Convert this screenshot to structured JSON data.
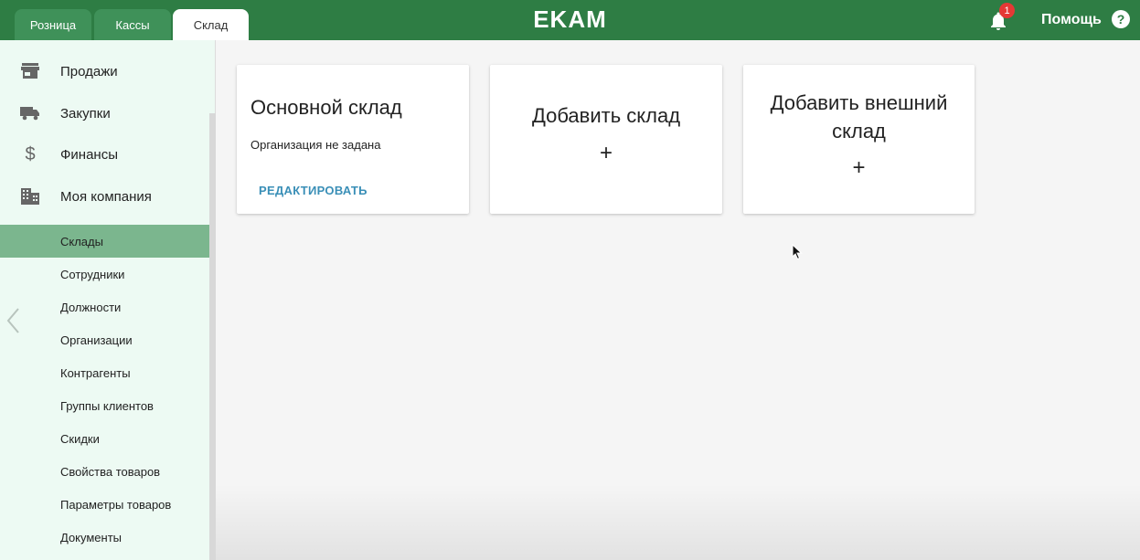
{
  "tabs": [
    {
      "label": "Розница"
    },
    {
      "label": "Кассы"
    },
    {
      "label": "Склад"
    }
  ],
  "active_tab": "Склад",
  "logo": "EKAM",
  "notifications": {
    "count": "1",
    "icon": "bell-icon"
  },
  "help": {
    "label": "Помощь",
    "icon": "help-icon",
    "glyph": "?"
  },
  "sidebar": {
    "sections": [
      {
        "label": "Продажи",
        "icon": "store-icon"
      },
      {
        "label": "Закупки",
        "icon": "truck-icon"
      },
      {
        "label": "Финансы",
        "icon": "dollar-icon"
      },
      {
        "label": "Моя компания",
        "icon": "building-icon"
      }
    ],
    "items": [
      {
        "label": "Склады",
        "active": true
      },
      {
        "label": "Сотрудники"
      },
      {
        "label": "Должности"
      },
      {
        "label": "Организации"
      },
      {
        "label": "Контрагенты"
      },
      {
        "label": "Группы клиентов"
      },
      {
        "label": "Скидки"
      },
      {
        "label": "Свойства товаров"
      },
      {
        "label": "Параметры товаров"
      },
      {
        "label": "Документы"
      }
    ]
  },
  "cards": {
    "main": {
      "title": "Основной склад",
      "subtitle": "Организация не задана",
      "action": "РЕДАКТИРОВАТЬ"
    },
    "add": {
      "title": "Добавить склад",
      "plus": "+"
    },
    "add_external": {
      "title_line1": "Добавить внешний",
      "title_line2": "склад",
      "plus": "+"
    }
  },
  "colors": {
    "header": "#2e7d44",
    "tab": "#3f9159",
    "sidebar_bg": "#edfaf3",
    "active_item": "#7bb68e",
    "link": "#3a8fb7",
    "badge": "#e53935"
  }
}
